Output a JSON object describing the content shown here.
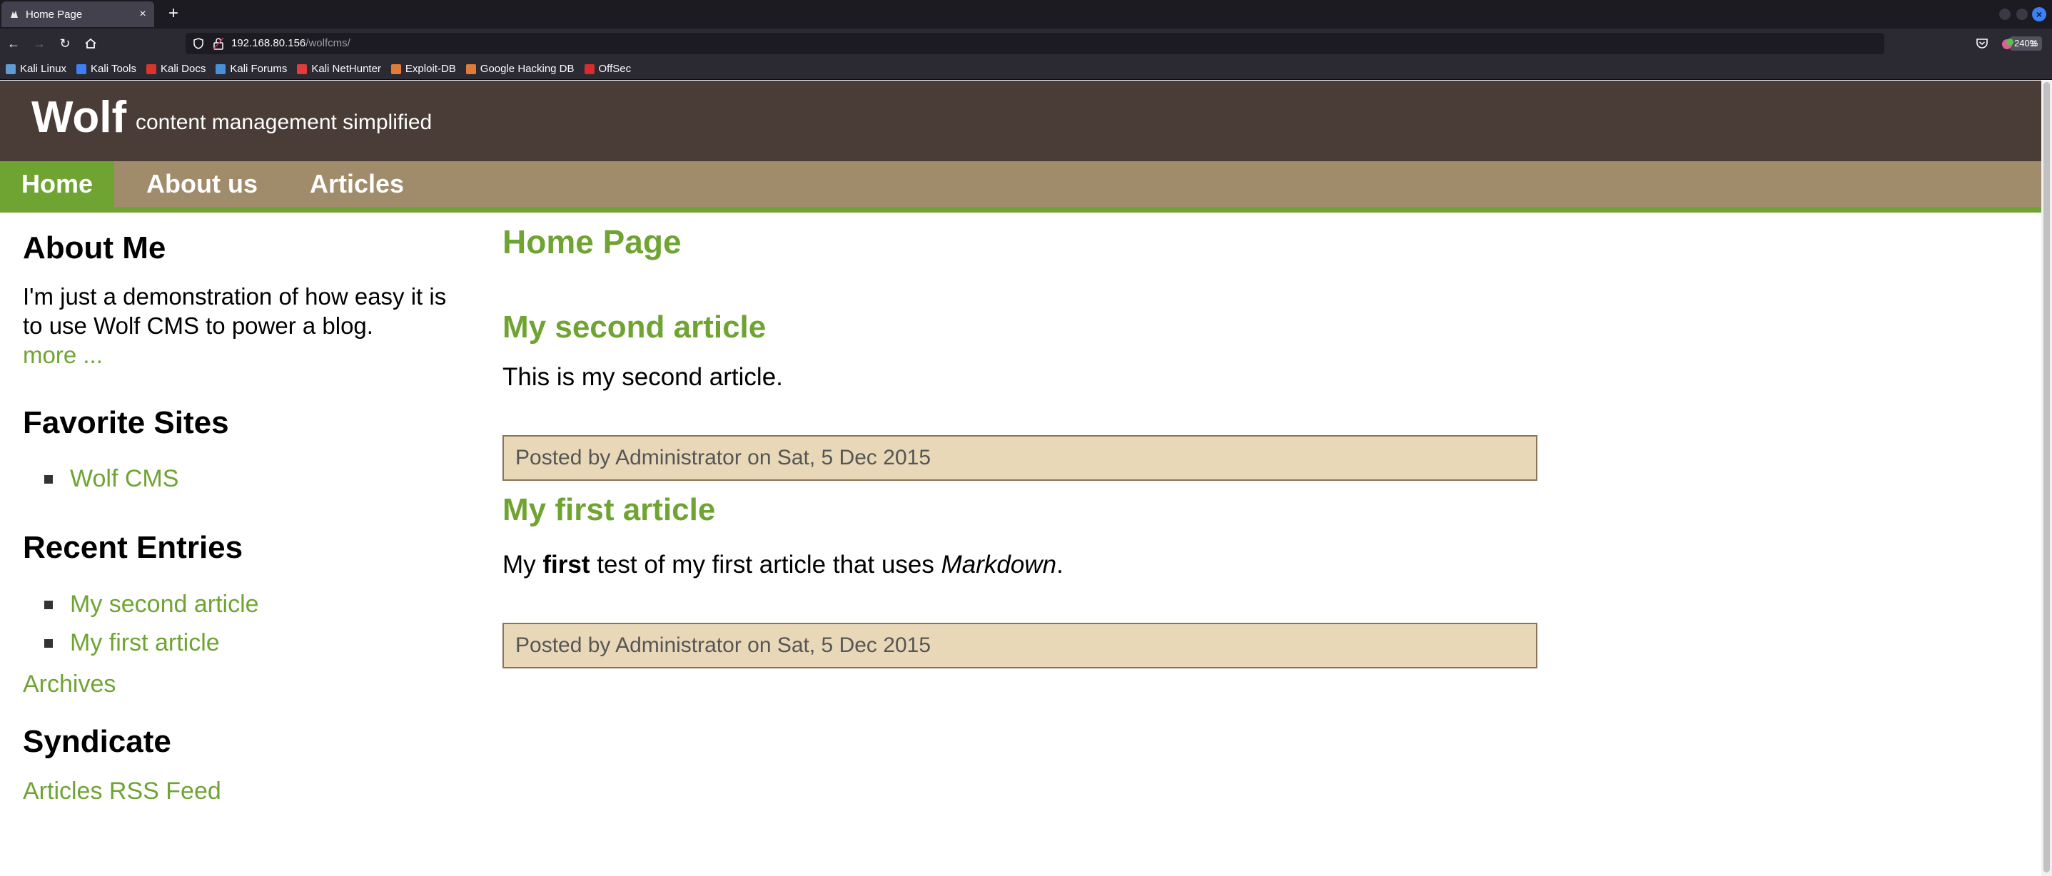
{
  "browser": {
    "tab_title": "Home Page",
    "url_host": "192.168.80.156",
    "url_path": "/wolfcms/",
    "zoom": "240%",
    "bookmarks": [
      {
        "label": "Kali Linux",
        "color": "#5f9ccf"
      },
      {
        "label": "Kali Tools",
        "color": "#3d7ff5"
      },
      {
        "label": "Kali Docs",
        "color": "#d9352b"
      },
      {
        "label": "Kali Forums",
        "color": "#4a90d9"
      },
      {
        "label": "Kali NetHunter",
        "color": "#e23b3b"
      },
      {
        "label": "Exploit-DB",
        "color": "#e07b39"
      },
      {
        "label": "Google Hacking DB",
        "color": "#e07b39"
      },
      {
        "label": "OffSec",
        "color": "#d62d2d"
      }
    ]
  },
  "site": {
    "name": "Wolf",
    "slogan": "content management simplified",
    "colors": {
      "header": "#4a3c37",
      "nav": "#a08b6b",
      "accent": "#6fa432",
      "info_bg": "#e8d8b8"
    }
  },
  "nav": {
    "items": [
      {
        "label": "Home",
        "current": true
      },
      {
        "label": "About us",
        "current": false
      },
      {
        "label": "Articles",
        "current": false
      }
    ]
  },
  "sidebar": {
    "about_heading": "About Me",
    "about_text": "I'm just a demonstration of how easy it is to use Wolf CMS to power a blog.",
    "about_more": "more ...",
    "favorites_heading": "Favorite Sites",
    "favorites": [
      "Wolf CMS"
    ],
    "recent_heading": "Recent Entries",
    "recent": [
      "My second article",
      "My first article"
    ],
    "archives": "Archives",
    "syndicate_heading": "Syndicate",
    "rss": "Articles RSS Feed"
  },
  "main": {
    "page_title": "Home Page",
    "articles": [
      {
        "title": "My second article",
        "body": "This is my second article.",
        "info": "Posted by Administrator on Sat, 5 Dec 2015"
      },
      {
        "title": "My first article",
        "body_pre": "My ",
        "body_bold": "first",
        "body_mid": " test of my first article that uses ",
        "body_em": "Markdown",
        "body_post": ".",
        "info": "Posted by Administrator on Sat, 5 Dec 2015"
      }
    ]
  }
}
